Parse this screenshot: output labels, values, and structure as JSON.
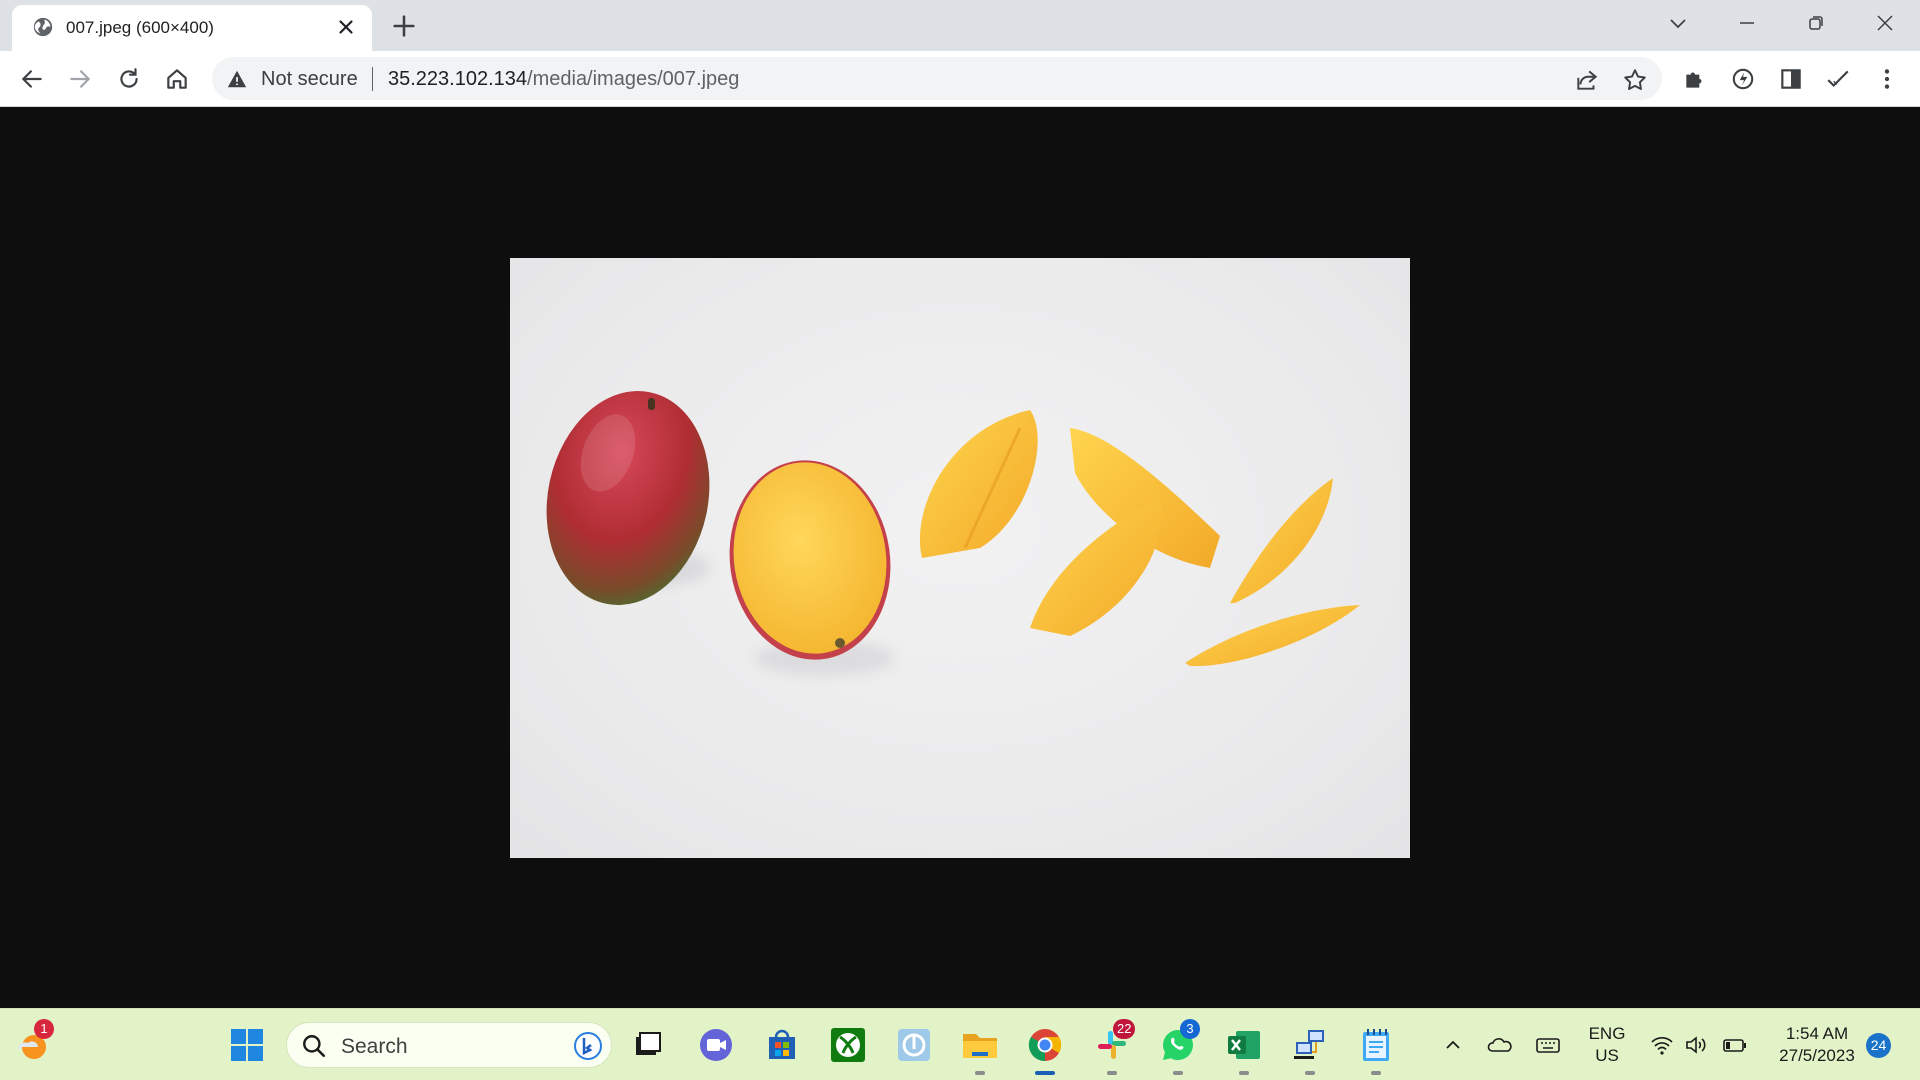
{
  "browser": {
    "tab": {
      "title": "007.jpeg (600×400)",
      "favicon": "globe-icon"
    },
    "omnibox": {
      "security_label": "Not secure",
      "url_host": "35.223.102.134",
      "url_path": "/media/images/007.jpeg"
    }
  },
  "content": {
    "image_subject": "mango-photo",
    "background_color": "#0e0e0e"
  },
  "taskbar": {
    "weather_badge": "1",
    "search_label": "Search",
    "slack_badge": "22",
    "whatsapp_badge": "3",
    "lang_primary": "ENG",
    "lang_secondary": "US",
    "time": "1:54 AM",
    "date": "27/5/2023",
    "notification_count": "24"
  },
  "colors": {
    "accent": "#1a73e8",
    "taskbar_bg": "#e3f3c8",
    "slack_badge": "#c0163c",
    "whatsapp_badge": "#1668d4"
  }
}
